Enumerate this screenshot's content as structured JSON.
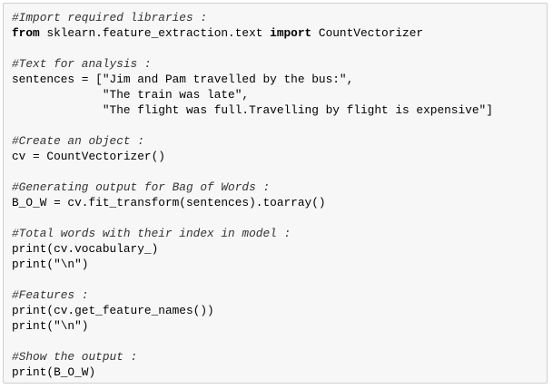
{
  "code_cell": {
    "lines": [
      [
        {
          "t": "comment",
          "v": "#Import required libraries :"
        }
      ],
      [
        {
          "t": "kw",
          "v": "from"
        },
        {
          "t": "n",
          "v": " sklearn.feature_extraction.text "
        },
        {
          "t": "kw",
          "v": "import"
        },
        {
          "t": "n",
          "v": " CountVectorizer"
        }
      ],
      [],
      [
        {
          "t": "comment",
          "v": "#Text for analysis :"
        }
      ],
      [
        {
          "t": "n",
          "v": "sentences = [\"Jim and Pam travelled by the bus:\","
        }
      ],
      [
        {
          "t": "n",
          "v": "             \"The train was late\","
        }
      ],
      [
        {
          "t": "n",
          "v": "             \"The flight was full.Travelling by flight is expensive\"]"
        }
      ],
      [],
      [
        {
          "t": "comment",
          "v": "#Create an object :"
        }
      ],
      [
        {
          "t": "n",
          "v": "cv = CountVectorizer()"
        }
      ],
      [],
      [
        {
          "t": "comment",
          "v": "#Generating output for Bag of Words :"
        }
      ],
      [
        {
          "t": "n",
          "v": "B_O_W = cv.fit_transform(sentences).toarray()"
        }
      ],
      [],
      [
        {
          "t": "comment",
          "v": "#Total words with their index in model :"
        }
      ],
      [
        {
          "t": "n",
          "v": "print(cv.vocabulary_)"
        }
      ],
      [
        {
          "t": "n",
          "v": "print(\"\\n\")"
        }
      ],
      [],
      [
        {
          "t": "comment",
          "v": "#Features :"
        }
      ],
      [
        {
          "t": "n",
          "v": "print(cv.get_feature_names())"
        }
      ],
      [
        {
          "t": "n",
          "v": "print(\"\\n\")"
        }
      ],
      [],
      [
        {
          "t": "comment",
          "v": "#Show the output :"
        }
      ],
      [
        {
          "t": "n",
          "v": "print(B_O_W)"
        }
      ]
    ]
  }
}
